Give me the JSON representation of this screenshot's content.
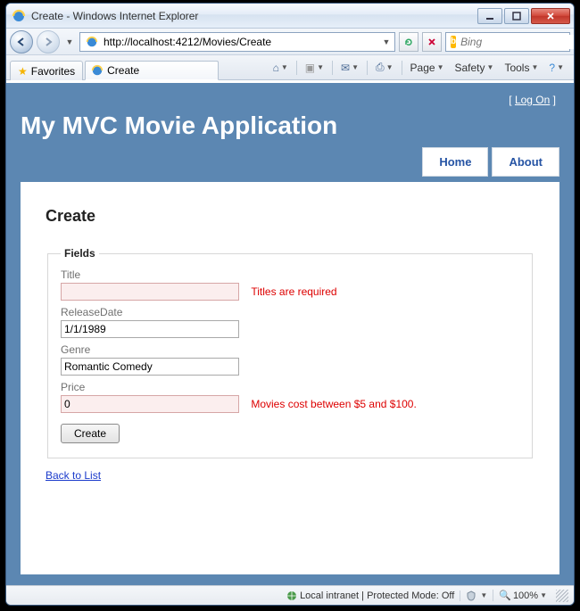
{
  "window": {
    "title": "Create - Windows Internet Explorer"
  },
  "nav": {
    "url": "http://localhost:4212/Movies/Create",
    "url_host": "localhost",
    "search_placeholder": "Bing"
  },
  "tabbar": {
    "favorites_label": "Favorites",
    "tab_title": "Create"
  },
  "commands": {
    "page": "Page",
    "safety": "Safety",
    "tools": "Tools"
  },
  "app": {
    "logon_label": "Log On",
    "title": "My MVC Movie Application",
    "nav": {
      "home": "Home",
      "about": "About"
    }
  },
  "page": {
    "heading": "Create",
    "legend": "Fields",
    "fields": {
      "title": {
        "label": "Title",
        "value": "",
        "error": "Titles are required"
      },
      "releaseDate": {
        "label": "ReleaseDate",
        "value": "1/1/1989"
      },
      "genre": {
        "label": "Genre",
        "value": "Romantic Comedy"
      },
      "price": {
        "label": "Price",
        "value": "0",
        "error": "Movies cost between $5 and $100."
      }
    },
    "submit_label": "Create",
    "back_label": "Back to List"
  },
  "status": {
    "zone": "Local intranet | Protected Mode: Off",
    "zoom": "100%"
  }
}
